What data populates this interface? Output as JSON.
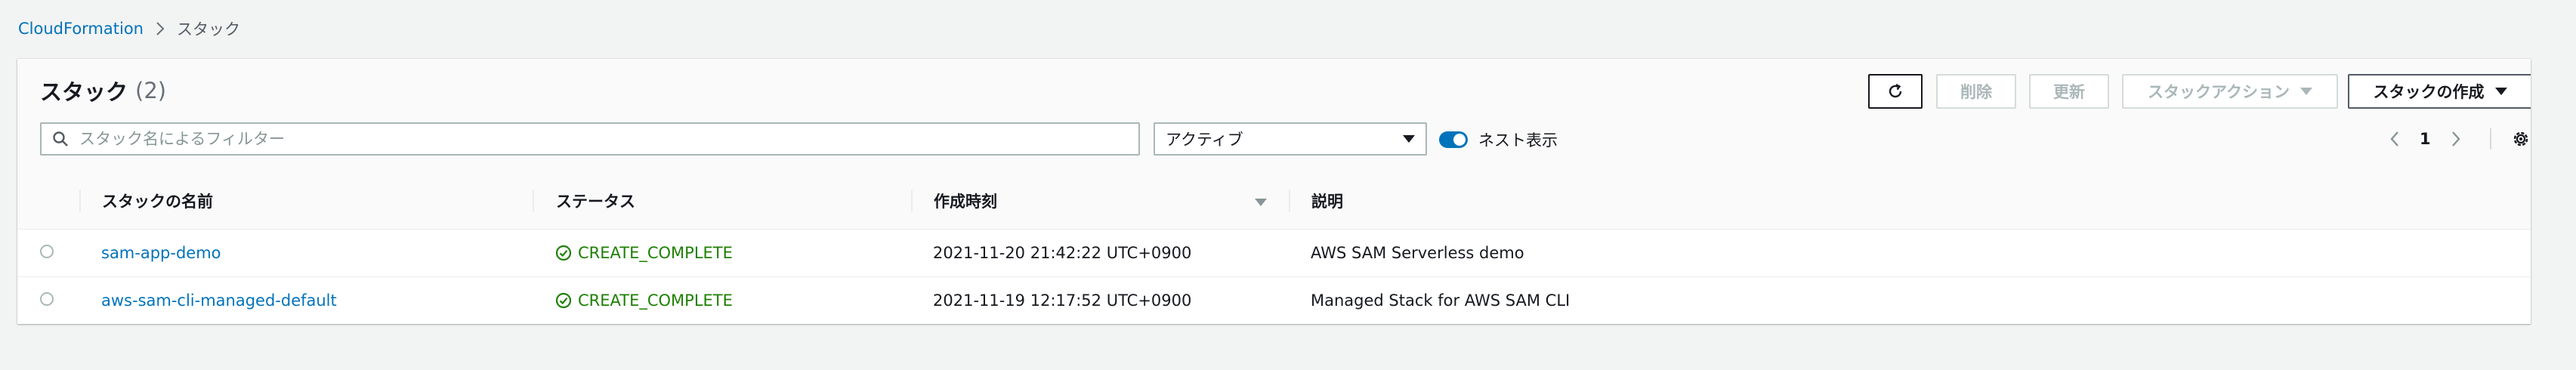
{
  "breadcrumb": {
    "root": "CloudFormation",
    "current": "スタック"
  },
  "panel": {
    "title": "スタック",
    "count": "(2)"
  },
  "toolbar": {
    "delete_label": "削除",
    "update_label": "更新",
    "actions_label": "スタックアクション",
    "create_label": "スタックの作成"
  },
  "filter": {
    "search_placeholder": "スタック名によるフィルター",
    "search_value": "",
    "status_selected": "アクティブ",
    "nested_toggle_label": "ネスト表示",
    "nested_toggle_on": true
  },
  "pagination": {
    "current_page": "1"
  },
  "table": {
    "columns": [
      "スタックの名前",
      "ステータス",
      "作成時刻",
      "説明"
    ],
    "rows": [
      {
        "name": "sam-app-demo",
        "status": "CREATE_COMPLETE",
        "created": "2021-11-20 21:42:22 UTC+0900",
        "description": "AWS SAM Serverless demo"
      },
      {
        "name": "aws-sam-cli-managed-default",
        "status": "CREATE_COMPLETE",
        "created": "2021-11-19 12:17:52 UTC+0900",
        "description": "Managed Stack for AWS SAM CLI"
      }
    ]
  },
  "colors": {
    "link": "#0073bb",
    "success": "#1d8102",
    "disabled_text": "#aab7b8",
    "text": "#16191f"
  }
}
